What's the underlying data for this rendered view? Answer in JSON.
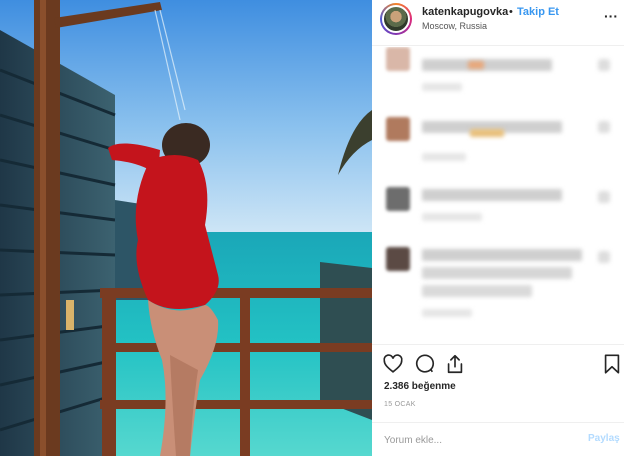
{
  "post": {
    "username": "katenkapugovka",
    "separator": "•",
    "follow_label": "Takip Et",
    "location": "Moscow, Russia",
    "more_label": "···"
  },
  "engagement": {
    "likes": "2.386 beğenme",
    "date": "15 OCAK"
  },
  "comment_box": {
    "placeholder": "Yorum ekle...",
    "post_label": "Paylaş"
  },
  "icons": {
    "like": "heart-icon",
    "comment": "comment-icon",
    "share": "share-icon",
    "save": "bookmark-icon",
    "more": "more-options-icon"
  },
  "colors": {
    "accent": "#3897f0",
    "post_disabled": "#b3dbff",
    "text": "#262626",
    "muted": "#999999"
  }
}
